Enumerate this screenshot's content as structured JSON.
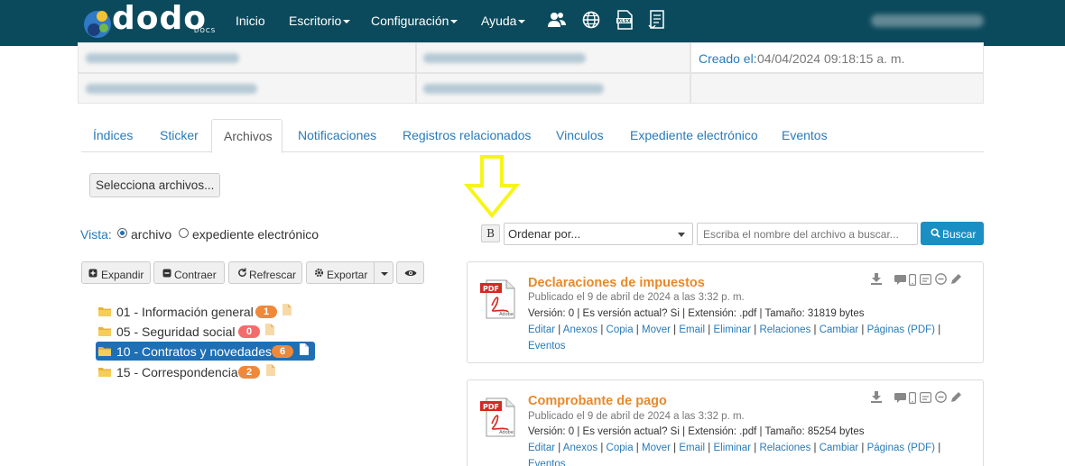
{
  "navbar": {
    "logo_text": "dodo",
    "logo_sub": "DOCS",
    "items": [
      {
        "label": "Inicio",
        "caret": false
      },
      {
        "label": "Escritorio",
        "caret": true
      },
      {
        "label": "Configuración",
        "caret": true
      },
      {
        "label": "Ayuda",
        "caret": true
      }
    ],
    "icons": [
      "users-icon",
      "globe-icon",
      "xlsx-file-icon",
      "document-list-icon"
    ]
  },
  "info": {
    "created_label": "Creado el:",
    "created_value": "04/04/2024 09:18:15 a. m."
  },
  "tabs": [
    {
      "label": "Índices"
    },
    {
      "label": "Sticker"
    },
    {
      "label": "Archivos"
    },
    {
      "label": "Notificaciones"
    },
    {
      "label": "Registros relacionados"
    },
    {
      "label": "Vinculos"
    },
    {
      "label": "Expediente electrónico"
    },
    {
      "label": "Eventos"
    }
  ],
  "upload": {
    "label": "Selecciona archivos..."
  },
  "view": {
    "label": "Vista:",
    "options": [
      {
        "label": "archivo",
        "selected": true
      },
      {
        "label": "expediente electrónico",
        "selected": false
      }
    ]
  },
  "toolbar": {
    "expand": "Expandir",
    "collapse": "Contraer",
    "refresh": "Refrescar",
    "export": "Exportar"
  },
  "tree": [
    {
      "label": "01 - Información general",
      "count": "1",
      "badge_color": "#f0883a",
      "selected": false
    },
    {
      "label": "05 - Seguridad social",
      "count": "0",
      "badge_color": "#f26c6c",
      "selected": false
    },
    {
      "label": "10 - Contratos y novedades",
      "count": "6",
      "badge_color": "#f0883a",
      "selected": true
    },
    {
      "label": "15 - Correspondencia",
      "count": "2",
      "badge_color": "#f0883a",
      "selected": false
    }
  ],
  "file_toolbar": {
    "bold_label": "B",
    "order_placeholder": "Ordenar por...",
    "search_placeholder": "Escriba el nombre del archivo a buscar...",
    "search_button": "Buscar"
  },
  "annotation_color": "#f5f51a",
  "files": [
    {
      "title": "Declaraciones de impuestos",
      "published": "Publicado el 9 de abril de 2024 a las 3:32 p. m.",
      "info": "Versión: 0 | Es versión actual? Si | Extensión: .pdf | Tamaño: 31819 bytes",
      "actions": [
        "Editar",
        "Anexos",
        "Copia",
        "Mover",
        "Email",
        "Eliminar",
        "Relaciones",
        "Cambiar",
        "Páginas (PDF)",
        "Eventos"
      ]
    },
    {
      "title": "Comprobante de pago",
      "published": "Publicado el 9 de abril de 2024 a las 3:32 p. m.",
      "info": "Versión: 0 | Es versión actual? Si | Extensión: .pdf | Tamaño: 85254 bytes",
      "actions": [
        "Editar",
        "Anexos",
        "Copia",
        "Mover",
        "Email",
        "Eliminar",
        "Relaciones",
        "Cambiar",
        "Páginas (PDF)",
        "Eventos"
      ]
    }
  ]
}
